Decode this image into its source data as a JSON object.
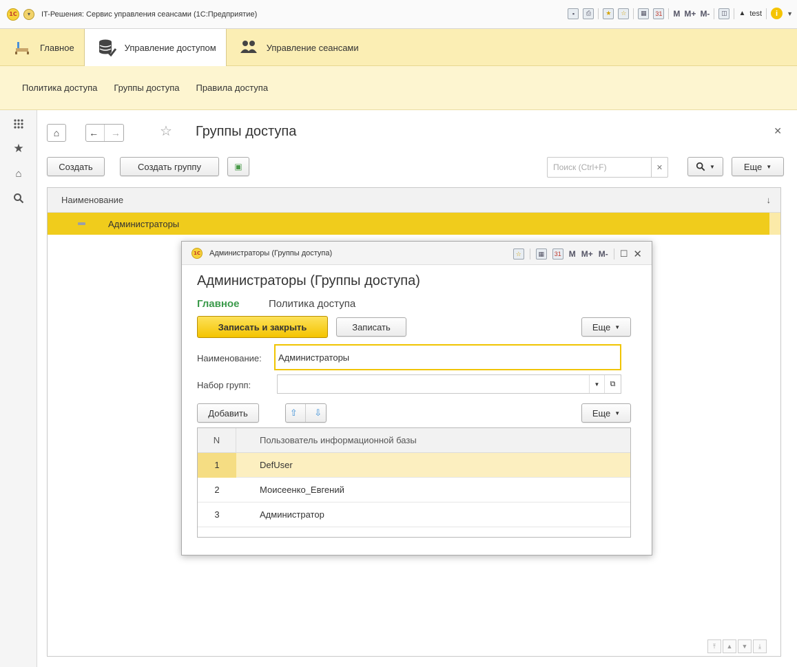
{
  "window": {
    "app_title": "IT-Решения: Сервис управления сеансами  (1С:Предприятие)",
    "logo_text": "1С",
    "m": "M",
    "m_plus": "M+",
    "m_minus": "M-",
    "user": "test",
    "info": "i"
  },
  "sections": [
    {
      "label": "Главное",
      "icon": "home-desk-icon"
    },
    {
      "label": "Управление доступом",
      "icon": "database-check-icon"
    },
    {
      "label": "Управление сеансами",
      "icon": "users-icon"
    }
  ],
  "functions": [
    "Политика доступа",
    "Группы доступа",
    "Правила доступа"
  ],
  "form": {
    "title": "Группы доступа",
    "create_label": "Создать",
    "create_group_label": "Создать группу",
    "search_placeholder": "Поиск (Ctrl+F)",
    "more_label": "Еще",
    "column_name": "Наименование",
    "sort_indicator": "↓",
    "rows": [
      {
        "label": "Администраторы"
      }
    ]
  },
  "modal": {
    "title": "Администраторы (Группы доступа)",
    "heading": "Администраторы (Группы доступа)",
    "tabs": [
      {
        "label": "Главное",
        "active": true
      },
      {
        "label": "Политика доступа",
        "active": false
      }
    ],
    "save_close_label": "Записать и закрыть",
    "save_label": "Записать",
    "more_label": "Еще",
    "name_label": "Наименование:",
    "name_value": "Администраторы",
    "group_set_label": "Набор групп:",
    "group_set_value": "",
    "add_label": "Добавить",
    "table": {
      "col_n": "N",
      "col_user": "Пользователь информационной базы",
      "rows": [
        {
          "n": "1",
          "user": "DefUser"
        },
        {
          "n": "2",
          "user": "Моисеенко_Евгений"
        },
        {
          "n": "3",
          "user": "Администратор"
        }
      ]
    }
  },
  "colors": {
    "accent_yellow": "#f0cc1c",
    "section_bg": "#fbeeb4",
    "active_tab_green": "#3a9a4a"
  }
}
